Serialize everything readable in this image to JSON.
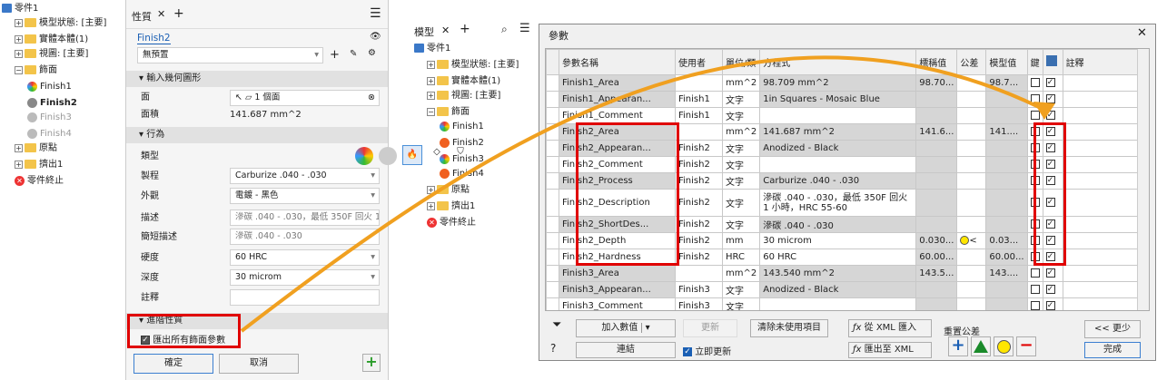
{
  "left_tree": {
    "items": [
      {
        "label": "零件1",
        "indent": 0
      },
      {
        "label": "模型狀態: [主要]",
        "indent": 1
      },
      {
        "label": "實體本體(1)",
        "indent": 1
      },
      {
        "label": "視圖: [主要]",
        "indent": 1
      },
      {
        "label": "飾面",
        "indent": 1
      },
      {
        "label": "Finish1",
        "indent": 2
      },
      {
        "label": "Finish2",
        "indent": 2
      },
      {
        "label": "Finish3",
        "indent": 2
      },
      {
        "label": "Finish4",
        "indent": 2
      },
      {
        "label": "原點",
        "indent": 1
      },
      {
        "label": "擠出1",
        "indent": 1
      },
      {
        "label": "零件終止",
        "indent": 1
      }
    ]
  },
  "props_panel": {
    "tab_label": "性質",
    "finish_name": "Finish2",
    "preset": "無預置",
    "section_geom": "輸入幾何圖形",
    "face_label": "面",
    "face_value": "1 個面",
    "area_label": "面積",
    "area_value": "141.687 mm^2",
    "section_behavior": "行為",
    "type_label": "類型",
    "process_label": "製程",
    "process_value": "Carburize .040 - .030",
    "appearance_label": "外觀",
    "appearance_value": "電鍍 - 黑色",
    "desc_label": "描述",
    "desc_value": "滲碳 .040 - .030，最低 350F 回火 1 小",
    "short_label": "簡短描述",
    "short_value": "滲碳 .040 - .030",
    "hardness_label": "硬度",
    "hardness_value": "60 HRC",
    "depth_label": "深度",
    "depth_value": "30 microm",
    "comment_label": "註釋",
    "section_adv": "進階性質",
    "export_label": "匯出所有飾面參數",
    "ok": "確定",
    "cancel": "取消"
  },
  "model_panel": {
    "tab_label": "模型",
    "items": [
      {
        "label": "零件1"
      },
      {
        "label": "模型狀態: [主要]"
      },
      {
        "label": "實體本體(1)"
      },
      {
        "label": "視圖: [主要]"
      },
      {
        "label": "飾面"
      },
      {
        "label": "Finish1"
      },
      {
        "label": "Finish2"
      },
      {
        "label": "Finish3"
      },
      {
        "label": "Finish4"
      },
      {
        "label": "原點"
      },
      {
        "label": "擠出1"
      },
      {
        "label": "零件終止"
      }
    ]
  },
  "params_dialog": {
    "title": "參數",
    "columns": [
      "參數名稱",
      "使用者",
      "單位/類",
      "方程式",
      "標稱值",
      "公差",
      "模型值",
      "鍵",
      "",
      "註釋"
    ],
    "rows": [
      {
        "name": "Finish1_Area",
        "user": "",
        "unit": "mm^2",
        "eq": "98.709 mm^2",
        "nom": "98.70...",
        "tol": "",
        "model": "98.7...",
        "key": false,
        "exp": true,
        "gray": true
      },
      {
        "name": "Finish1_Appearan...",
        "user": "Finish1",
        "unit": "文字",
        "eq": "1in Squares - Mosaic Blue",
        "nom": "",
        "tol": "",
        "model": "",
        "key": false,
        "exp": true,
        "gray": true
      },
      {
        "name": "Finish1_Comment",
        "user": "Finish1",
        "unit": "文字",
        "eq": "",
        "nom": "",
        "tol": "",
        "model": "",
        "key": false,
        "exp": true,
        "gray": false
      },
      {
        "name": "Finish2_Area",
        "user": "",
        "unit": "mm^2",
        "eq": "141.687 mm^2",
        "nom": "141.6...",
        "tol": "",
        "model": "141....",
        "key": false,
        "exp": true,
        "gray": true
      },
      {
        "name": "Finish2_Appearan...",
        "user": "Finish2",
        "unit": "文字",
        "eq": "Anodized - Black",
        "nom": "",
        "tol": "",
        "model": "",
        "key": false,
        "exp": true,
        "gray": true
      },
      {
        "name": "Finish2_Comment",
        "user": "Finish2",
        "unit": "文字",
        "eq": "",
        "nom": "",
        "tol": "",
        "model": "",
        "key": false,
        "exp": true,
        "gray": false
      },
      {
        "name": "Finish2_Process",
        "user": "Finish2",
        "unit": "文字",
        "eq": "Carburize .040 - .030",
        "nom": "",
        "tol": "",
        "model": "",
        "key": false,
        "exp": true,
        "gray": true
      },
      {
        "name": "Finish2_Description",
        "user": "Finish2",
        "unit": "文字",
        "eq": "滲碳 .040 - .030，最低 350F 回火 1 小時，HRC 55-60",
        "nom": "",
        "tol": "",
        "model": "",
        "key": false,
        "exp": true,
        "gray": false,
        "tall": true
      },
      {
        "name": "Finish2_ShortDes...",
        "user": "Finish2",
        "unit": "文字",
        "eq": "滲碳 .040 - .030",
        "nom": "",
        "tol": "",
        "model": "",
        "key": false,
        "exp": true,
        "gray": true
      },
      {
        "name": "Finish2_Depth",
        "user": "Finish2",
        "unit": "mm",
        "eq": "30 microm",
        "nom": "0.030...",
        "tol": "●<",
        "model": "0.03...",
        "key": false,
        "exp": true,
        "gray": false
      },
      {
        "name": "Finish2_Hardness",
        "user": "Finish2",
        "unit": "HRC",
        "eq": "60 HRC",
        "nom": "60.00...",
        "tol": "",
        "model": "60.00...",
        "key": false,
        "exp": true,
        "gray": false
      },
      {
        "name": "Finish3_Area",
        "user": "",
        "unit": "mm^2",
        "eq": "143.540 mm^2",
        "nom": "143.5...",
        "tol": "",
        "model": "143....",
        "key": false,
        "exp": true,
        "gray": true
      },
      {
        "name": "Finish3_Appearan...",
        "user": "Finish3",
        "unit": "文字",
        "eq": "Anodized - Black",
        "nom": "",
        "tol": "",
        "model": "",
        "key": false,
        "exp": true,
        "gray": true
      },
      {
        "name": "Finish3_Comment",
        "user": "Finish3",
        "unit": "文字",
        "eq": "",
        "nom": "",
        "tol": "",
        "model": "",
        "key": false,
        "exp": true,
        "gray": false
      }
    ],
    "add_numeric": "加入數值",
    "update": "更新",
    "purge": "清除未使用項目",
    "import_xml": "從 XML 匯入",
    "link": "連結",
    "immediate": "立即更新",
    "export_xml": "匯出至 XML",
    "reset_tol": "重置公差",
    "less": "<< 更少",
    "done": "完成"
  },
  "colors": {
    "red": "#e00000",
    "arrow": "#f0a020",
    "blue": "#1a5fb4"
  }
}
